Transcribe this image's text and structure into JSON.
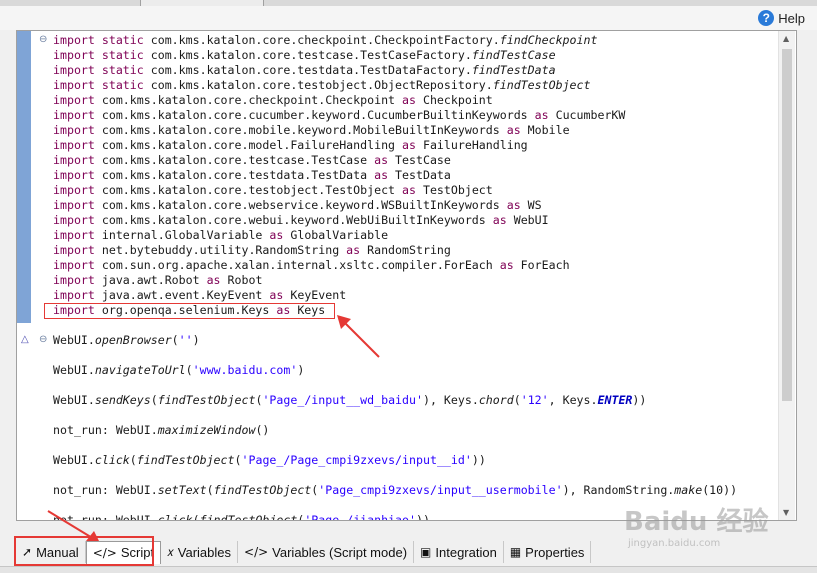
{
  "header": {
    "help_label": "Help"
  },
  "editor": {
    "lines": [
      {
        "segments": [
          {
            "t": "import static",
            "c": "kw"
          },
          {
            "t": " com.kms.katalon.core.checkpoint.CheckpointFactory."
          },
          {
            "t": "findCheckpoint",
            "c": "fn"
          }
        ]
      },
      {
        "segments": [
          {
            "t": "import static",
            "c": "kw"
          },
          {
            "t": " com.kms.katalon.core.testcase.TestCaseFactory."
          },
          {
            "t": "findTestCase",
            "c": "fn"
          }
        ]
      },
      {
        "segments": [
          {
            "t": "import static",
            "c": "kw"
          },
          {
            "t": " com.kms.katalon.core.testdata.TestDataFactory."
          },
          {
            "t": "findTestData",
            "c": "fn"
          }
        ]
      },
      {
        "segments": [
          {
            "t": "import static",
            "c": "kw"
          },
          {
            "t": " com.kms.katalon.core.testobject.ObjectRepository."
          },
          {
            "t": "findTestObject",
            "c": "fn"
          }
        ]
      },
      {
        "segments": [
          {
            "t": "import",
            "c": "kw"
          },
          {
            "t": " com.kms.katalon.core.checkpoint.Checkpoint "
          },
          {
            "t": "as",
            "c": "kw"
          },
          {
            "t": " Checkpoint"
          }
        ]
      },
      {
        "segments": [
          {
            "t": "import",
            "c": "kw"
          },
          {
            "t": " com.kms.katalon.core.cucumber.keyword.CucumberBuiltinKeywords "
          },
          {
            "t": "as",
            "c": "kw"
          },
          {
            "t": " CucumberKW"
          }
        ]
      },
      {
        "segments": [
          {
            "t": "import",
            "c": "kw"
          },
          {
            "t": " com.kms.katalon.core.mobile.keyword.MobileBuiltInKeywords "
          },
          {
            "t": "as",
            "c": "kw"
          },
          {
            "t": " Mobile"
          }
        ]
      },
      {
        "segments": [
          {
            "t": "import",
            "c": "kw"
          },
          {
            "t": " com.kms.katalon.core.model.FailureHandling "
          },
          {
            "t": "as",
            "c": "kw"
          },
          {
            "t": " FailureHandling"
          }
        ]
      },
      {
        "segments": [
          {
            "t": "import",
            "c": "kw"
          },
          {
            "t": " com.kms.katalon.core.testcase.TestCase "
          },
          {
            "t": "as",
            "c": "kw"
          },
          {
            "t": " TestCase"
          }
        ]
      },
      {
        "segments": [
          {
            "t": "import",
            "c": "kw"
          },
          {
            "t": " com.kms.katalon.core.testdata.TestData "
          },
          {
            "t": "as",
            "c": "kw"
          },
          {
            "t": " TestData"
          }
        ]
      },
      {
        "segments": [
          {
            "t": "import",
            "c": "kw"
          },
          {
            "t": " com.kms.katalon.core.testobject.TestObject "
          },
          {
            "t": "as",
            "c": "kw"
          },
          {
            "t": " TestObject"
          }
        ]
      },
      {
        "segments": [
          {
            "t": "import",
            "c": "kw"
          },
          {
            "t": " com.kms.katalon.core.webservice.keyword.WSBuiltInKeywords "
          },
          {
            "t": "as",
            "c": "kw"
          },
          {
            "t": " WS"
          }
        ]
      },
      {
        "segments": [
          {
            "t": "import",
            "c": "kw"
          },
          {
            "t": " com.kms.katalon.core.webui.keyword.WebUiBuiltInKeywords "
          },
          {
            "t": "as",
            "c": "kw"
          },
          {
            "t": " WebUI"
          }
        ]
      },
      {
        "segments": [
          {
            "t": "import",
            "c": "kw"
          },
          {
            "t": " internal.GlobalVariable "
          },
          {
            "t": "as",
            "c": "kw"
          },
          {
            "t": " GlobalVariable"
          }
        ]
      },
      {
        "segments": [
          {
            "t": "import",
            "c": "kw"
          },
          {
            "t": " net.bytebuddy.utility.RandomString "
          },
          {
            "t": "as",
            "c": "kw"
          },
          {
            "t": " RandomString"
          }
        ]
      },
      {
        "segments": [
          {
            "t": "import",
            "c": "kw"
          },
          {
            "t": " com.sun.org.apache.xalan.internal.xsltc.compiler.ForEach "
          },
          {
            "t": "as",
            "c": "kw"
          },
          {
            "t": " ForEach"
          }
        ]
      },
      {
        "segments": [
          {
            "t": "import",
            "c": "kw"
          },
          {
            "t": " java.awt.Robot "
          },
          {
            "t": "as",
            "c": "kw"
          },
          {
            "t": " Robot"
          }
        ]
      },
      {
        "segments": [
          {
            "t": "import",
            "c": "kw"
          },
          {
            "t": " java.awt.event.KeyEvent "
          },
          {
            "t": "as",
            "c": "kw"
          },
          {
            "t": " KeyEvent"
          }
        ]
      },
      {
        "segments": [
          {
            "t": "import",
            "c": "kw"
          },
          {
            "t": " org.openqa.selenium.Keys "
          },
          {
            "t": "as",
            "c": "kw"
          },
          {
            "t": " Keys"
          }
        ]
      },
      {
        "gap": true
      },
      {
        "segments": [
          {
            "t": "WebUI."
          },
          {
            "t": "openBrowser",
            "c": "fn"
          },
          {
            "t": "("
          },
          {
            "t": "''",
            "c": "str"
          },
          {
            "t": ")"
          }
        ]
      },
      {
        "gap": true
      },
      {
        "segments": [
          {
            "t": "WebUI."
          },
          {
            "t": "navigateToUrl",
            "c": "fn"
          },
          {
            "t": "("
          },
          {
            "t": "'www.baidu.com'",
            "c": "str"
          },
          {
            "t": ")"
          }
        ]
      },
      {
        "gap": true
      },
      {
        "segments": [
          {
            "t": "WebUI."
          },
          {
            "t": "sendKeys",
            "c": "fn"
          },
          {
            "t": "("
          },
          {
            "t": "findTestObject",
            "c": "fn"
          },
          {
            "t": "("
          },
          {
            "t": "'Page_/input__wd_baidu'",
            "c": "str"
          },
          {
            "t": "), Keys."
          },
          {
            "t": "chord",
            "c": "fn"
          },
          {
            "t": "("
          },
          {
            "t": "'12'",
            "c": "str"
          },
          {
            "t": ", Keys."
          },
          {
            "t": "ENTER",
            "c": "cst"
          },
          {
            "t": "))"
          }
        ]
      },
      {
        "gap": true
      },
      {
        "segments": [
          {
            "t": "not_run: WebUI."
          },
          {
            "t": "maximizeWindow",
            "c": "fn"
          },
          {
            "t": "()"
          }
        ]
      },
      {
        "gap": true
      },
      {
        "segments": [
          {
            "t": "WebUI."
          },
          {
            "t": "click",
            "c": "fn"
          },
          {
            "t": "("
          },
          {
            "t": "findTestObject",
            "c": "fn"
          },
          {
            "t": "("
          },
          {
            "t": "'Page_/Page_cmpi9zxevs/input__id'",
            "c": "str"
          },
          {
            "t": "))"
          }
        ]
      },
      {
        "gap": true
      },
      {
        "segments": [
          {
            "t": "not_run: WebUI."
          },
          {
            "t": "setText",
            "c": "fn"
          },
          {
            "t": "("
          },
          {
            "t": "findTestObject",
            "c": "fn"
          },
          {
            "t": "("
          },
          {
            "t": "'Page_cmpi9zxevs/input__usermobile'",
            "c": "str"
          },
          {
            "t": "), RandomString."
          },
          {
            "t": "make",
            "c": "fn"
          },
          {
            "t": "(10))"
          }
        ]
      },
      {
        "gap": true
      },
      {
        "segments": [
          {
            "t": "not_run: WebUI."
          },
          {
            "t": "click",
            "c": "fn"
          },
          {
            "t": "("
          },
          {
            "t": "findTestObject",
            "c": "fn"
          },
          {
            "t": "("
          },
          {
            "t": "'Page_/jianhiao'",
            "c": "str"
          },
          {
            "t": "))"
          }
        ]
      }
    ]
  },
  "tabs": [
    {
      "label": "Manual",
      "icon": "cursor-icon",
      "glyph": "➚",
      "active": false
    },
    {
      "label": "Script",
      "icon": "code-icon",
      "glyph": "</>",
      "active": true
    },
    {
      "label": "Variables",
      "icon": "variable-x-icon",
      "glyph": "𝑥",
      "active": false
    },
    {
      "label": "Variables (Script mode)",
      "icon": "code-icon",
      "glyph": "</>",
      "active": false
    },
    {
      "label": "Integration",
      "icon": "integration-icon",
      "glyph": "▣",
      "active": false
    },
    {
      "label": "Properties",
      "icon": "table-icon",
      "glyph": "▦",
      "active": false
    }
  ],
  "colors": {
    "keyword": "#7f0055",
    "string": "#2a00ff",
    "constant": "#0000c0",
    "annotation_red": "#e53935",
    "ruler_blue": "#7fa4d6"
  },
  "watermark": {
    "text": "Baidu 经验",
    "subtext": "jingyan.baidu.com"
  }
}
